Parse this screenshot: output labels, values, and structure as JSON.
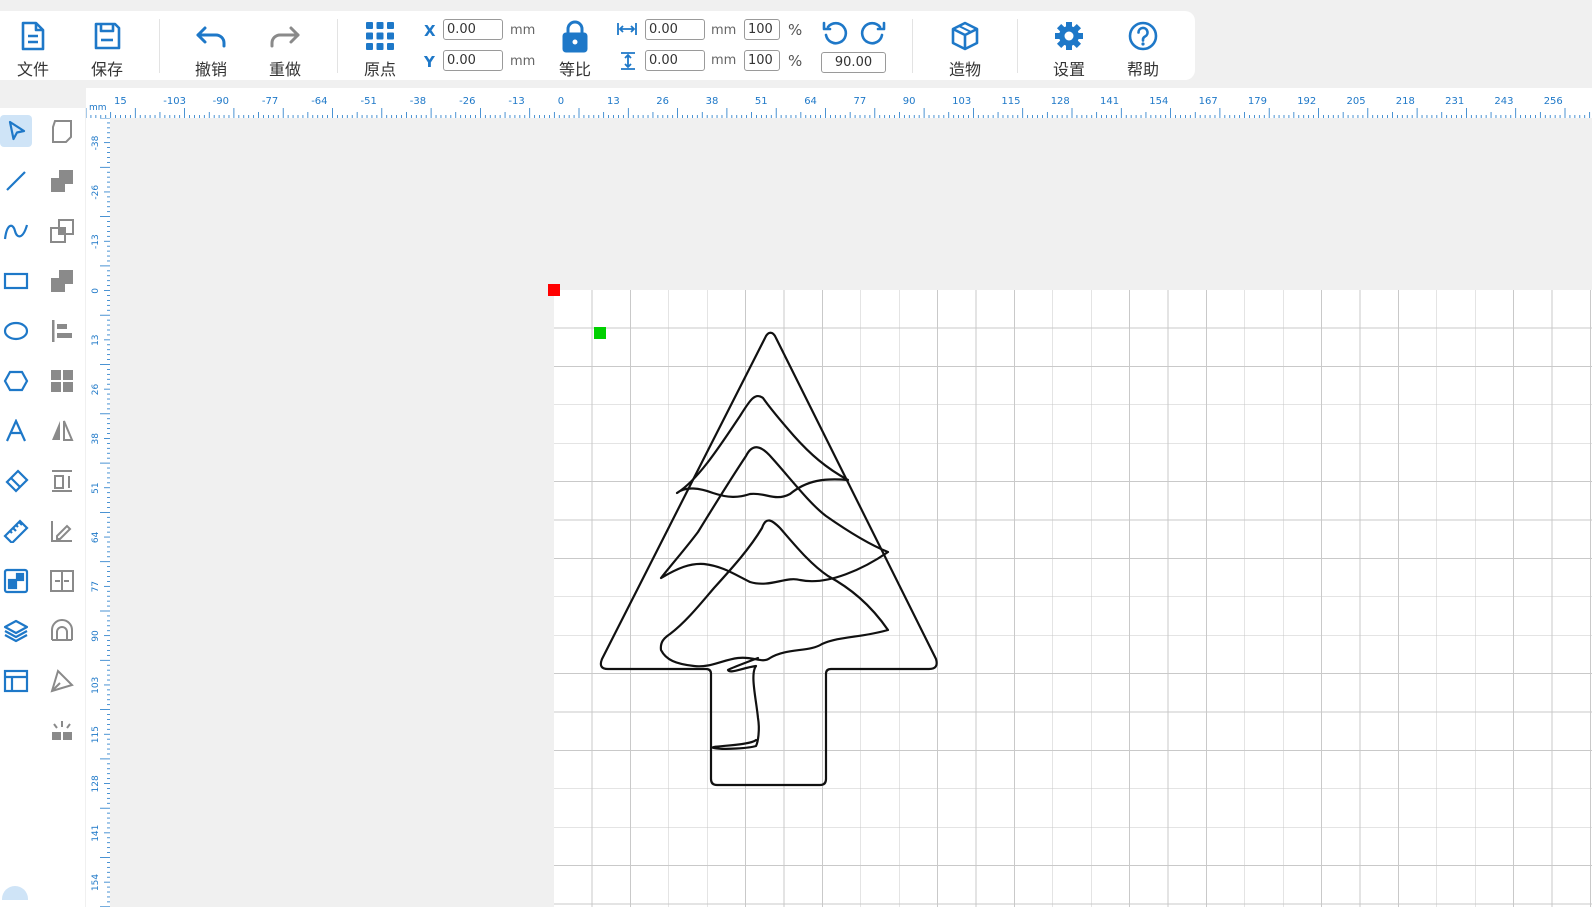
{
  "toolbar": {
    "file_label": "文件",
    "save_label": "保存",
    "undo_label": "撤销",
    "redo_label": "重做",
    "origin_label": "原点",
    "ratio_label": "等比",
    "build_label": "造物",
    "settings_label": "设置",
    "help_label": "帮助",
    "x_label": "X",
    "y_label": "Y",
    "x_value": "0.00",
    "y_value": "0.00",
    "width_value": "0.00",
    "height_value": "0.00",
    "width_pct": "100",
    "height_pct": "100",
    "unit_mm": "mm",
    "percent": "%",
    "rotate_value": "90.00"
  },
  "ruler": {
    "unit": "mm",
    "h_ticks": [
      "15",
      "-103",
      "-90",
      "-77",
      "-64",
      "-51",
      "-38",
      "-26",
      "-13",
      "0",
      "13",
      "26",
      "38",
      "51",
      "64",
      "77",
      "90",
      "103",
      "115",
      "128",
      "141",
      "154",
      "167",
      "179",
      "192",
      "205",
      "218",
      "231",
      "243",
      "256"
    ],
    "v_ticks": [
      "-38",
      "-26",
      "-13",
      "0",
      "13",
      "26",
      "38",
      "51",
      "64",
      "77",
      "90",
      "103",
      "115",
      "128",
      "141",
      "154"
    ]
  },
  "colors": {
    "accent": "#1e78c8",
    "disabled": "#8a8a8a",
    "origin_marker": "#ff0000",
    "start_marker": "#00d000"
  },
  "side_tools": {
    "left": [
      "select-icon",
      "line-icon",
      "curve-icon",
      "rectangle-icon",
      "ellipse-icon",
      "polygon-icon",
      "text-icon",
      "eraser-icon",
      "measure-icon",
      "array-icon",
      "layers-icon",
      "panel-icon"
    ],
    "right": [
      "node-edit-icon",
      "combine-icon",
      "copy-icon",
      "subtract-icon",
      "align-left-icon",
      "grid-arrange-icon",
      "mirror-icon",
      "distribute-icon",
      "sign-icon",
      "spacing-icon",
      "heart-icon",
      "pen-icon",
      "sparkle-icon"
    ]
  }
}
